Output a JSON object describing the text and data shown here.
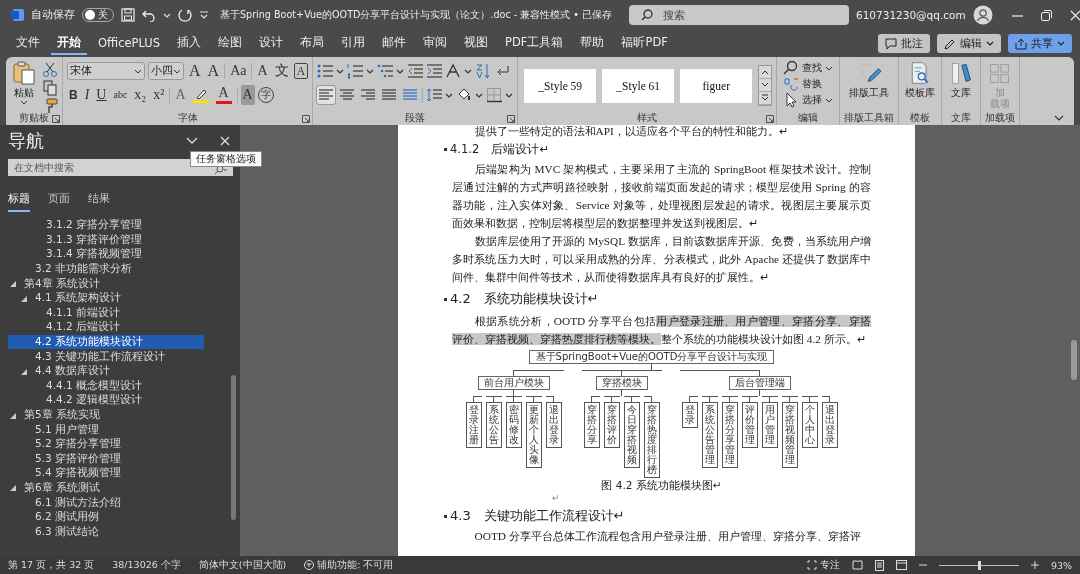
{
  "title_bar": {
    "autosave": {
      "label": "自动保存",
      "on": false,
      "state_text": "关"
    },
    "title": "基于Spring Boot+Vue的OOTD分享平台设计与实现（论文）.doc  -  兼容性模式 • 已保存",
    "search": {
      "placeholder": "搜索"
    },
    "account": "610731230@qq.com"
  },
  "menu": {
    "tabs": [
      {
        "label": "文件",
        "selected": false
      },
      {
        "label": "开始",
        "selected": true
      },
      {
        "label": "OfficePLUS",
        "selected": false
      },
      {
        "label": "插入",
        "selected": false
      },
      {
        "label": "绘图",
        "selected": false
      },
      {
        "label": "设计",
        "selected": false
      },
      {
        "label": "布局",
        "selected": false
      },
      {
        "label": "引用",
        "selected": false
      },
      {
        "label": "邮件",
        "selected": false
      },
      {
        "label": "审阅",
        "selected": false
      },
      {
        "label": "视图",
        "selected": false
      },
      {
        "label": "PDF工具箱",
        "selected": false
      },
      {
        "label": "帮助",
        "selected": false
      },
      {
        "label": "福昕PDF",
        "selected": false
      }
    ],
    "actions": [
      {
        "kind": "comment",
        "label": "批注"
      },
      {
        "kind": "edit",
        "label": "编辑"
      },
      {
        "kind": "share",
        "label": "共享"
      }
    ]
  },
  "ribbon": {
    "groups": [
      {
        "kind": "clipboard",
        "label": "剪贴板",
        "paste": "粘贴"
      },
      {
        "kind": "font",
        "label": "字体",
        "font_name": "宋体",
        "font_size": "小四",
        "row1": [
          {
            "kind": "grow",
            "glyph": "A"
          },
          {
            "kind": "shrink",
            "glyph": "A"
          },
          {
            "kind": "case",
            "glyph": "Aa"
          },
          {
            "kind": "clear",
            "glyph": "A"
          },
          {
            "kind": "phonetic",
            "glyph": "文"
          },
          {
            "kind": "border",
            "glyph": "A"
          }
        ],
        "row2": [
          {
            "kind": "bold",
            "glyph": "B"
          },
          {
            "kind": "italic",
            "glyph": "I"
          },
          {
            "kind": "underline",
            "glyph": "U"
          },
          {
            "kind": "strike",
            "glyph": "abc"
          },
          {
            "kind": "sub",
            "glyph": "x₂"
          },
          {
            "kind": "sup",
            "glyph": "x²"
          },
          {
            "kind": "effects",
            "glyph": "A"
          },
          {
            "kind": "highlight",
            "color": "#f2e600"
          },
          {
            "kind": "fontcolor",
            "glyph": "A",
            "color": "#e0161e"
          },
          {
            "kind": "shading",
            "glyph": "A"
          },
          {
            "kind": "enclosed",
            "glyph": "字"
          }
        ]
      },
      {
        "kind": "paragraph",
        "label": "段落",
        "alignments": [
          {
            "selected": true
          },
          {
            "selected": false
          },
          {
            "selected": false
          },
          {
            "selected": false
          },
          {
            "selected": false
          }
        ]
      },
      {
        "kind": "styles",
        "label": "样式",
        "styles": [
          "_Style 59",
          "_Style 61",
          "figuer"
        ]
      },
      {
        "kind": "editing",
        "label": "编辑",
        "items": [
          {
            "kind": "find",
            "label": "查找"
          },
          {
            "kind": "replace",
            "label": "替换"
          },
          {
            "kind": "select",
            "label": "选择"
          }
        ]
      },
      {
        "kind": "layout_tools",
        "label": "排版工具箱",
        "button": "排版工具",
        "disabled": false
      },
      {
        "kind": "templates",
        "label": "模板",
        "button": "模板库",
        "disabled": false
      },
      {
        "kind": "library",
        "label": "文库",
        "button": "文库",
        "disabled": false
      },
      {
        "kind": "addins",
        "label": "加载项",
        "button": "加载项",
        "disabled": true
      }
    ]
  },
  "navigation": {
    "title": "导航",
    "search": {
      "placeholder": "在文档中搜索"
    },
    "tooltip": "任务窗格选项",
    "tabs": [
      {
        "label": "标题",
        "selected": true
      },
      {
        "label": "页面",
        "selected": false
      },
      {
        "label": "结果",
        "selected": false
      }
    ],
    "tree": [
      {
        "children": [
          {
            "children": [
              {
                "label": "3.1.2  穿搭分享管理",
                "selected": false
              },
              {
                "label": "3.1.3  穿搭评价管理",
                "selected": false
              },
              {
                "label": "3.1.4  穿搭视频管理",
                "selected": false
              }
            ]
          },
          {
            "label": "3.2  非功能需求分析",
            "selected": false
          }
        ]
      },
      {
        "label": "第4章 系统设计",
        "selected": false,
        "expanded": true,
        "children": [
          {
            "label": "4.1  系统架构设计",
            "selected": false,
            "expanded": true,
            "children": [
              {
                "label": "4.1.1  前端设计",
                "selected": false
              },
              {
                "label": "4.1.2  后端设计",
                "selected": false
              }
            ]
          },
          {
            "label": "4.2  系统功能模块设计",
            "selected": true
          },
          {
            "label": "4.3  关键功能工作流程设计",
            "selected": false
          },
          {
            "label": "4.4  数据库设计",
            "selected": false,
            "expanded": true,
            "children": [
              {
                "label": "4.4.1  概念模型设计",
                "selected": false
              },
              {
                "label": "4.4.2  逻辑模型设计",
                "selected": false
              }
            ]
          }
        ]
      },
      {
        "label": "第5章 系统实现",
        "selected": false,
        "expanded": true,
        "children": [
          {
            "label": "5.1  用户管理",
            "selected": false
          },
          {
            "label": "5.2  穿搭分享管理",
            "selected": false
          },
          {
            "label": "5.3  穿搭评价管理",
            "selected": false
          },
          {
            "label": "5.4  穿搭视频管理",
            "selected": false
          }
        ]
      },
      {
        "label": "第6章 系统测试",
        "selected": false,
        "expanded": true,
        "children": [
          {
            "label": "6.1  测试方法介绍",
            "selected": false
          },
          {
            "label": "6.2  测试用例",
            "selected": false
          },
          {
            "label": "6.3  测试结论",
            "selected": false
          }
        ]
      }
    ]
  },
  "document": {
    "blocks": [
      {
        "kind": "paragraph",
        "text": "提供了一些特定的语法和API，以适应各个平台的特性和能力。↵"
      },
      {
        "kind": "subheading",
        "text": "4.1.2　后端设计↵"
      },
      {
        "kind": "paragraph",
        "text": "后端架构为 MVC 架构模式，主要采用了主流的 SpringBoot 框架技术设计。控制层通过注解的方式声明路径映射，接收前端页面发起的请求；模型层使用 Spring 的容器功能，注入实体对象、Service 对象等，处理视图层发起的请求。视图层主要展示页面效果和数据，控制层将模型层的数据整理并发送到视图层。↵"
      },
      {
        "kind": "paragraph",
        "text": "数据库层使用了开源的 MySQL 数据库，目前该数据库开源、免费，当系统用户增多时系统压力大时，可以采用成熟的分库、分表模式，此外 Apache 还提供了数据库中间件、集群中间件等技术，从而使得数据库具有良好的扩展性。↵"
      },
      {
        "kind": "heading",
        "text": "4.2　系统功能模块设计↵"
      },
      {
        "kind": "segmented",
        "segments": [
          {
            "text": "根据系统分析，OOTD 分享平台包括",
            "highlighted": false
          },
          {
            "text": "用户登录注册、用户管理、穿搭分享、穿搭评价、穿搭视频、穿搭热度排行榜等模块。",
            "highlighted": true
          },
          {
            "text": "整个系统的功能模块设计如图 4.2 所示。↵",
            "highlighted": false
          }
        ]
      },
      {
        "kind": "figure",
        "root": "基于SpringBoot+Vue的OOTD分享平台设计与实现",
        "groups": [
          {
            "label": "前台用户模块",
            "leaves": [
              "登录注册",
              "系统公告",
              "密码修改",
              "更新个人头像",
              "退出登录"
            ]
          },
          {
            "label": "穿搭模块",
            "leaves": [
              "穿搭分享",
              "穿搭评价",
              "今日穿搭视频",
              "穿搭热度排行榜"
            ]
          },
          {
            "label": "后台管理端",
            "leaves": [
              "登录",
              "系统公告管理",
              "穿搭分享管理",
              "评价管理",
              "用户管理",
              "穿搭视频管理",
              "个人中心",
              "退出登录"
            ]
          }
        ]
      },
      {
        "kind": "caption",
        "text": "图 4.2  系统功能模块图↵"
      },
      {
        "kind": "empty",
        "text": "↵"
      },
      {
        "kind": "heading",
        "text": "4.3　关键功能工作流程设计↵"
      },
      {
        "kind": "paragraph",
        "text": "OOTD 分享平台总体工作流程包含用户登录注册、用户管理、穿搭分享、穿搭评"
      }
    ]
  },
  "status_bar": {
    "page": "第 17 页，共 32 页",
    "words": "38/13026 个字",
    "language": "简体中文(中国大陆)",
    "accessibility": "辅助功能: 不可用",
    "focus": "专注",
    "zoom": {
      "level": 0.5,
      "text": "93%"
    }
  }
}
